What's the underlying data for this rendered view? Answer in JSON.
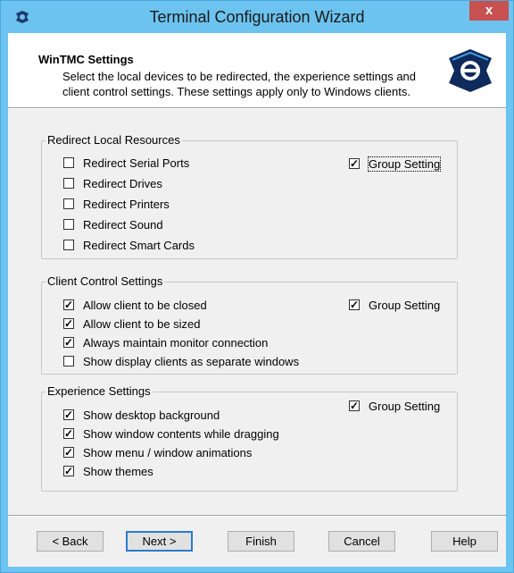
{
  "window": {
    "title": "Terminal Configuration Wizard",
    "close_label": "x"
  },
  "header": {
    "title": "WinTMC Settings",
    "description": "Select the local devices to be redirected, the experience settings and client control settings. These settings apply only to Windows clients."
  },
  "groups": [
    {
      "label": "Redirect Local Resources",
      "group_setting": {
        "label": "Group Setting",
        "checked": true
      },
      "items": [
        {
          "label": "Redirect Serial Ports",
          "checked": false
        },
        {
          "label": "Redirect Drives",
          "checked": false
        },
        {
          "label": "Redirect Printers",
          "checked": false
        },
        {
          "label": "Redirect Sound",
          "checked": false
        },
        {
          "label": "Redirect Smart Cards",
          "checked": false
        }
      ]
    },
    {
      "label": "Client Control Settings",
      "group_setting": {
        "label": "Group Setting",
        "checked": true
      },
      "items": [
        {
          "label": "Allow client to be closed",
          "checked": true
        },
        {
          "label": "Allow client to be sized",
          "checked": true
        },
        {
          "label": "Always maintain monitor connection",
          "checked": true
        },
        {
          "label": "Show display clients as separate windows",
          "checked": false
        }
      ]
    },
    {
      "label": "Experience Settings",
      "group_setting": {
        "label": "Group Setting",
        "checked": true
      },
      "items": [
        {
          "label": "Show desktop background",
          "checked": true
        },
        {
          "label": "Show window contents while dragging",
          "checked": true
        },
        {
          "label": "Show menu / window animations",
          "checked": true
        },
        {
          "label": "Show themes",
          "checked": true
        }
      ]
    }
  ],
  "buttons": {
    "back": "< Back",
    "next": "Next >",
    "finish": "Finish",
    "cancel": "Cancel",
    "help": "Help"
  },
  "colors": {
    "frame": "#6cc3ef",
    "close": "#c75050",
    "client": "#f0f0f0"
  }
}
